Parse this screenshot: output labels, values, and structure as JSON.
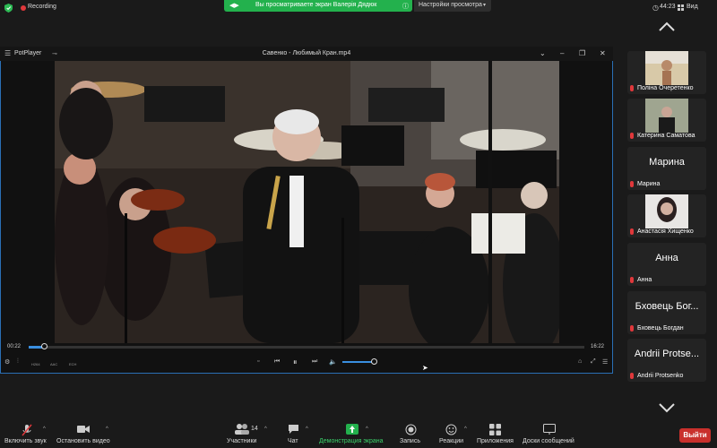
{
  "status": {
    "recording_label": "Recording",
    "clock": "44:23",
    "view_label": "Вид"
  },
  "share_banner": {
    "text": "Вы просматриваете экран Валерія Дядюк",
    "view_options": "Настройки просмотра",
    "info_icon": "info-icon"
  },
  "player": {
    "app_name": "PotPlayer",
    "file_title": "Савенко - Любимый Кран.mp4",
    "current_time": "00:22",
    "total_time": "16:22",
    "progress_fraction": 0.02,
    "volume_fraction": 0.9,
    "small_labels": [
      "H264",
      "AAC",
      "ECH"
    ]
  },
  "participants": [
    {
      "name": "Поліна Очеретенко",
      "type": "photo"
    },
    {
      "name": "Катерина Саматова",
      "type": "photo"
    },
    {
      "name": "Марина",
      "big": "Марина",
      "type": "name"
    },
    {
      "name": "Анастасія Хищенко",
      "type": "photo"
    },
    {
      "name": "Анна",
      "big": "Анна",
      "type": "name"
    },
    {
      "name": "Бховець Богдан",
      "big": "Бховець Бог...",
      "type": "name"
    },
    {
      "name": "Andrii Protsenko",
      "big": "Andrii Protse...",
      "type": "name"
    }
  ],
  "toolbar": {
    "unmute": "Включить звук",
    "start_video": "Остановить видео",
    "participants": "Участники",
    "participants_count": "14",
    "chat": "Чат",
    "share_screen": "Демонстрация экрана",
    "record": "Запись",
    "reactions": "Реакции",
    "apps": "Приложения",
    "whiteboard": "Доски сообщений",
    "leave": "Выйти"
  },
  "colors": {
    "recording": "#e0383b",
    "share_green": "#23b14d",
    "leave_red": "#c9302c",
    "accent_blue": "#3a8fe0"
  }
}
